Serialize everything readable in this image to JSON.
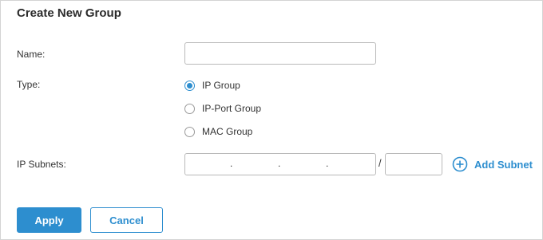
{
  "title": "Create New Group",
  "form": {
    "name_label": "Name:",
    "name_value": "",
    "type_label": "Type:",
    "type_options": [
      {
        "label": "IP Group",
        "selected": true
      },
      {
        "label": "IP-Port Group",
        "selected": false
      },
      {
        "label": "MAC Group",
        "selected": false
      }
    ],
    "subnets_label": "IP Subnets:",
    "ip_separator": ".",
    "mask_separator": "/",
    "subnet_mask_value": "",
    "add_subnet_label": "Add Subnet"
  },
  "buttons": {
    "apply": "Apply",
    "cancel": "Cancel"
  },
  "colors": {
    "accent": "#2d8ecf",
    "border": "#b9b9b9",
    "text": "#333333"
  },
  "icons": {
    "add_subnet": "plus-circle-icon"
  }
}
